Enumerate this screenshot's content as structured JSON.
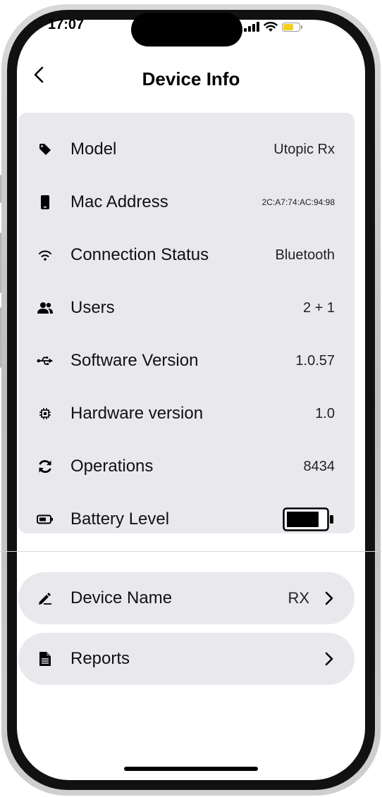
{
  "status_bar": {
    "time": "17:07"
  },
  "header": {
    "title": "Device Info"
  },
  "info": {
    "model": {
      "label": "Model",
      "value": "Utopic Rx",
      "icon": "tag-icon"
    },
    "mac": {
      "label": "Mac Address",
      "value": "2C:A7:74:AC:94:98",
      "icon": "phone-icon"
    },
    "connection": {
      "label": "Connection Status",
      "value": "Bluetooth",
      "icon": "wifi-icon"
    },
    "users": {
      "label": "Users",
      "value": "2 + 1",
      "icon": "users-icon"
    },
    "software": {
      "label": "Software Version",
      "value": "1.0.57",
      "icon": "usb-icon"
    },
    "hardware": {
      "label": "Hardware version",
      "value": "1.0",
      "icon": "chip-icon"
    },
    "operations": {
      "label": "Operations",
      "value": "8434",
      "icon": "refresh-icon"
    },
    "battery": {
      "label": "Battery Level",
      "icon": "battery-icon",
      "level_fraction": 0.85
    }
  },
  "actions": {
    "device_name": {
      "label": "Device Name",
      "value": "RX",
      "icon": "pen-icon"
    },
    "reports": {
      "label": "Reports",
      "icon": "document-icon"
    }
  }
}
